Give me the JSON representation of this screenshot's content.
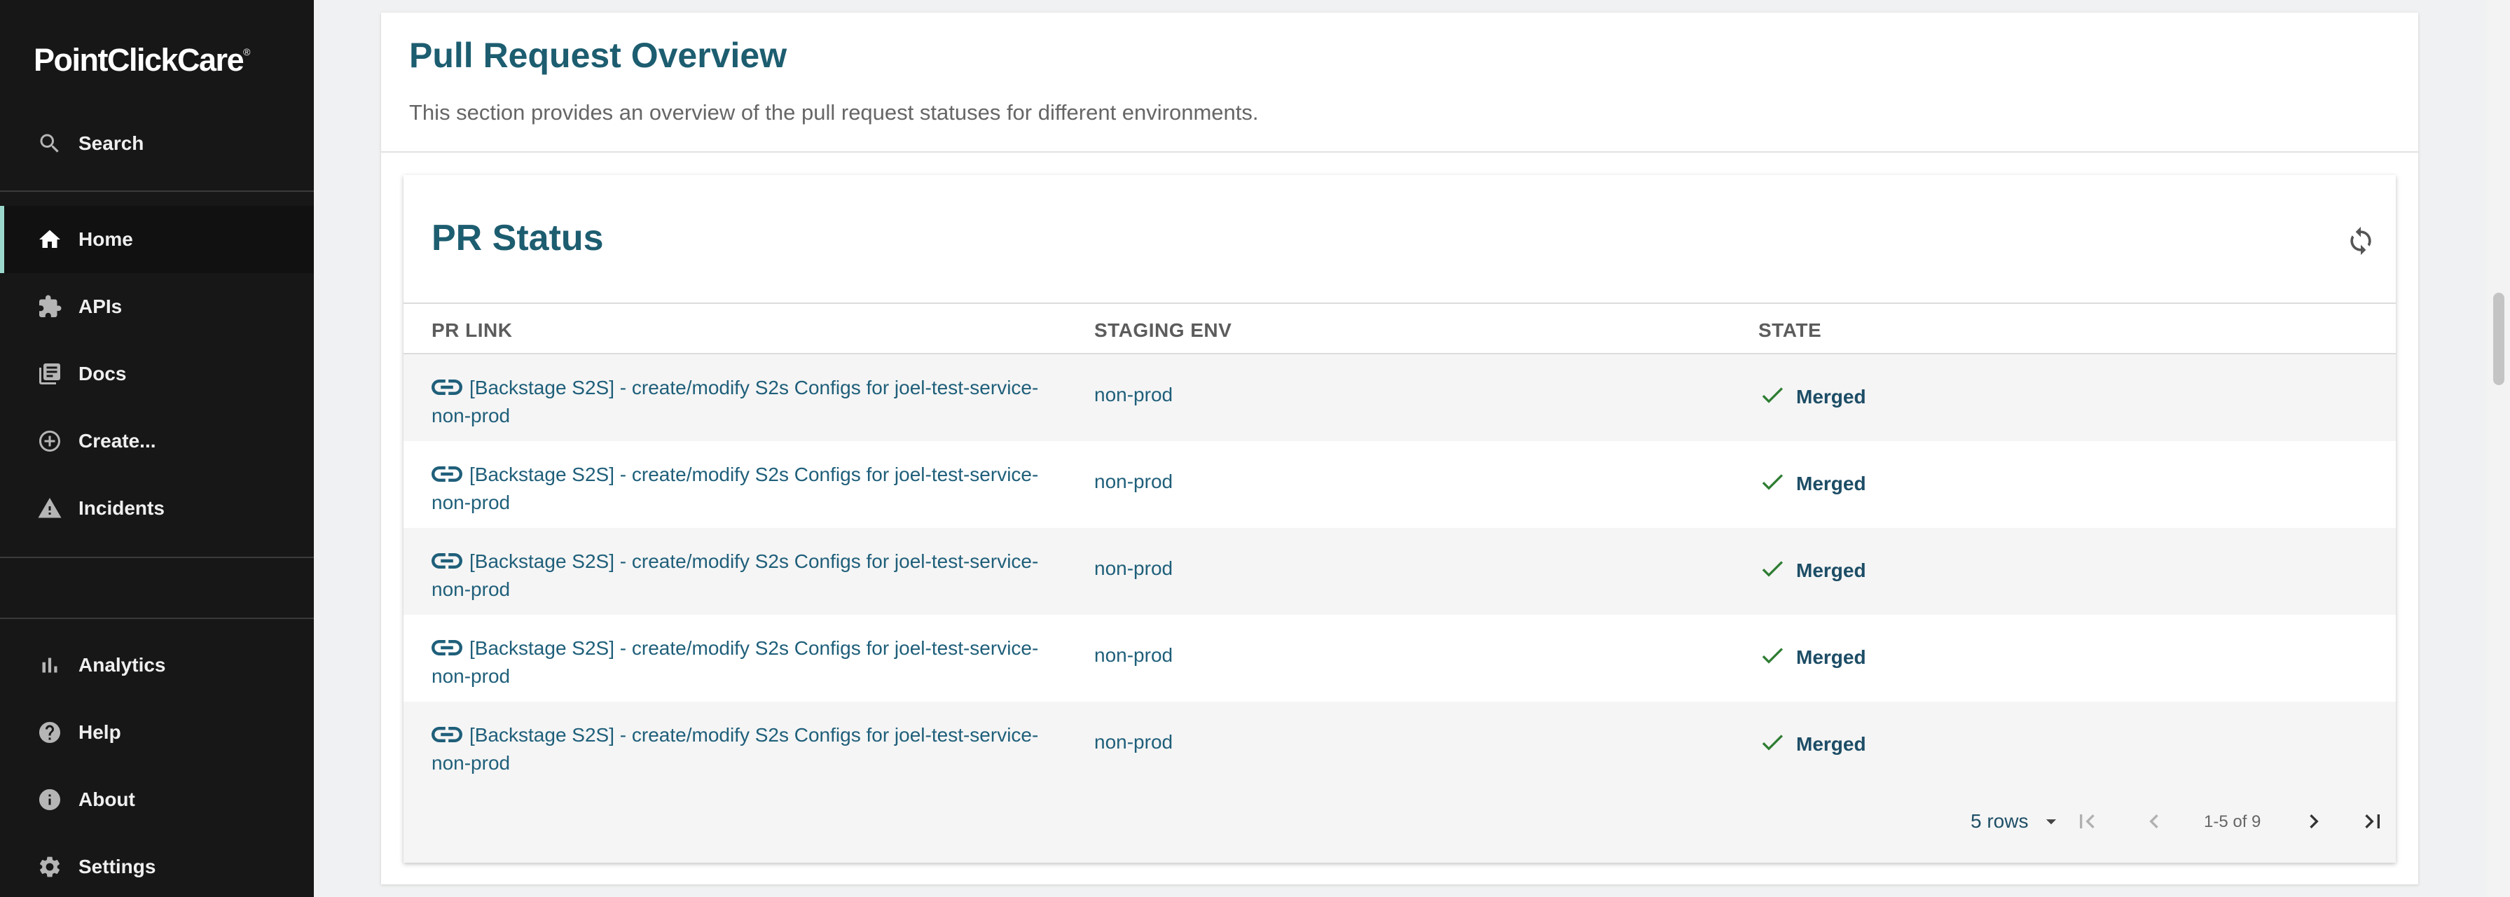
{
  "sidebar": {
    "logo": "PointClickCare",
    "logo_mark": "®",
    "items": [
      {
        "label": "Search",
        "icon": "search-icon"
      },
      {
        "label": "Home",
        "icon": "home-icon",
        "active": true
      },
      {
        "label": "APIs",
        "icon": "puzzle-icon"
      },
      {
        "label": "Docs",
        "icon": "library-books-icon"
      },
      {
        "label": "Create...",
        "icon": "add-circle-icon"
      },
      {
        "label": "Incidents",
        "icon": "warning-icon"
      },
      {
        "label": "Analytics",
        "icon": "bar-chart-icon"
      },
      {
        "label": "Help",
        "icon": "help-icon"
      },
      {
        "label": "About",
        "icon": "info-icon"
      },
      {
        "label": "Settings",
        "icon": "gear-icon"
      }
    ]
  },
  "overview": {
    "title": "Pull Request Overview",
    "description": "This section provides an overview of the pull request statuses for different environments."
  },
  "pr_status": {
    "title": "PR Status",
    "columns": [
      "PR LINK",
      "STAGING ENV",
      "STATE"
    ],
    "rows": [
      {
        "link_line1": "[Backstage S2S] - create/modify S2s Configs for joel-test-service-",
        "link_line2": "non-prod",
        "env": "non-prod",
        "state": "Merged"
      },
      {
        "link_line1": "[Backstage S2S] - create/modify S2s Configs for joel-test-service-",
        "link_line2": "non-prod",
        "env": "non-prod",
        "state": "Merged"
      },
      {
        "link_line1": "[Backstage S2S] - create/modify S2s Configs for joel-test-service-",
        "link_line2": "non-prod",
        "env": "non-prod",
        "state": "Merged"
      },
      {
        "link_line1": "[Backstage S2S] - create/modify S2s Configs for joel-test-service-",
        "link_line2": "non-prod",
        "env": "non-prod",
        "state": "Merged"
      },
      {
        "link_line1": "[Backstage S2S] - create/modify S2s Configs for joel-test-service-",
        "link_line2": "non-prod",
        "env": "non-prod",
        "state": "Merged"
      }
    ],
    "pagination": {
      "rows_per_page": "5 rows",
      "range": "1-5 of 9"
    }
  },
  "colors": {
    "sidebar_bg": "#171717",
    "active_indicator": "#9bd8cc",
    "title": "#1d5d70",
    "link": "#1f5f7a",
    "merged_check": "#2e7d32"
  }
}
